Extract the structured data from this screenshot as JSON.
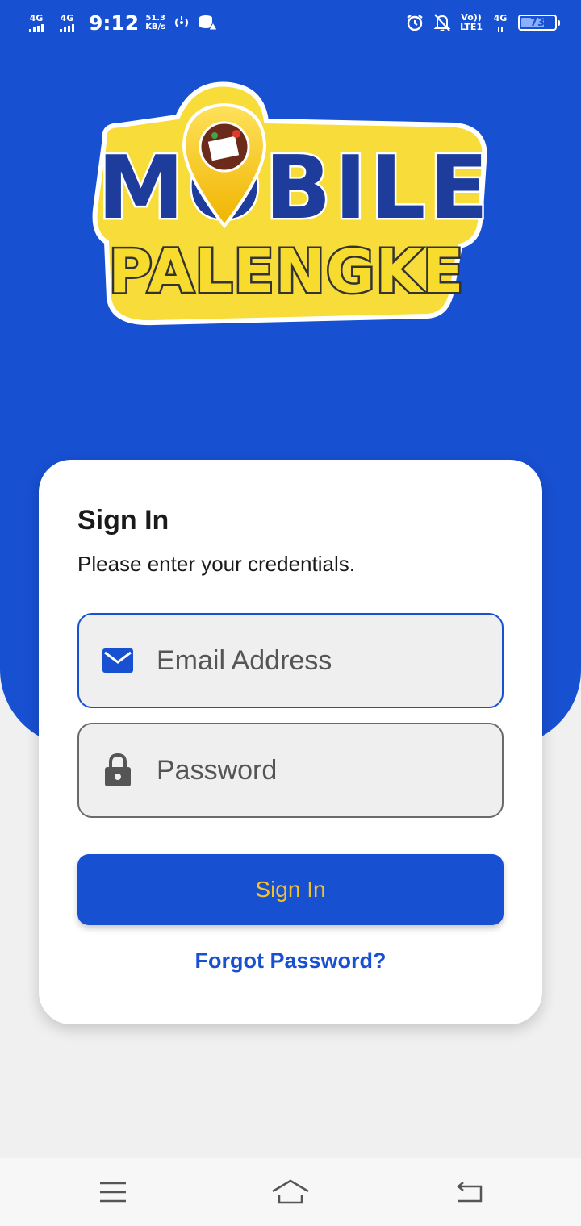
{
  "status_bar": {
    "sim1_tech": "4G",
    "sim2_tech": "4G",
    "time": "9:12",
    "speed_value": "51.3",
    "speed_unit": "KB/s",
    "volte_top": "Vo))",
    "volte_bottom": "LTE1",
    "right_tech": "4G",
    "battery_level": "73"
  },
  "logo": {
    "line1": "MOBILE",
    "line2": "PALENGKE"
  },
  "signin_card": {
    "title": "Sign In",
    "subtitle": "Please enter your credentials.",
    "email_placeholder": "Email Address",
    "password_placeholder": "Password",
    "signin_button": "Sign In",
    "forgot_link": "Forgot Password?"
  },
  "colors": {
    "brand_blue": "#1850d2",
    "brand_yellow": "#f2c12e",
    "background": "#f0f0f0"
  },
  "icons": [
    "menu-icon",
    "home-icon",
    "back-icon",
    "email-icon",
    "lock-icon"
  ]
}
